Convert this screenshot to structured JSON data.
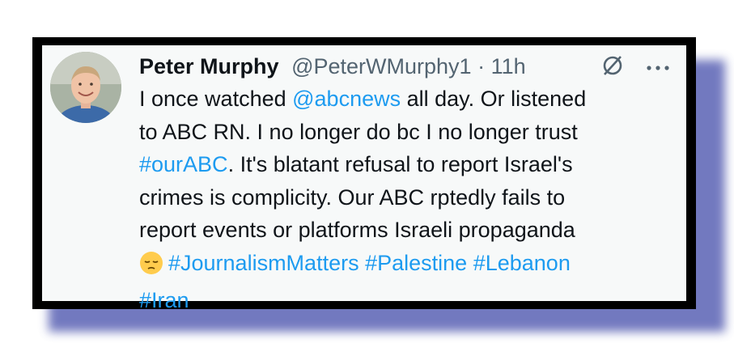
{
  "tweet": {
    "author_name": "Peter Murphy",
    "handle": "@PeterWMurphy1",
    "separator": "·",
    "time": "11h",
    "top_icons": [
      "grok-slash-icon",
      "more-dots-icon"
    ],
    "body": {
      "line1_a": "I once watched ",
      "mention": "@abcnews",
      "line1_b": " all day. Or listened",
      "line2": "to ABC RN. I no longer do bc I no longer trust",
      "hashtag_our_abc": "#ourABC",
      "line3_b": ". It's blatant refusal to report Israel's",
      "line4": "crimes is complicity. Our ABC rptedly fails to",
      "line5": "report events or platforms Israeli propaganda",
      "emoji_name": "pensive-face-emoji",
      "hashtags": [
        "#JournalismMatters",
        "#Palestine",
        "#Lebanon",
        "#Iran"
      ]
    }
  },
  "colors": {
    "frame": "#000000",
    "card_bg": "#f7f9f9",
    "link": "#1d9bf0",
    "secondary_text": "#536471",
    "shadow": "#5a62b4"
  }
}
